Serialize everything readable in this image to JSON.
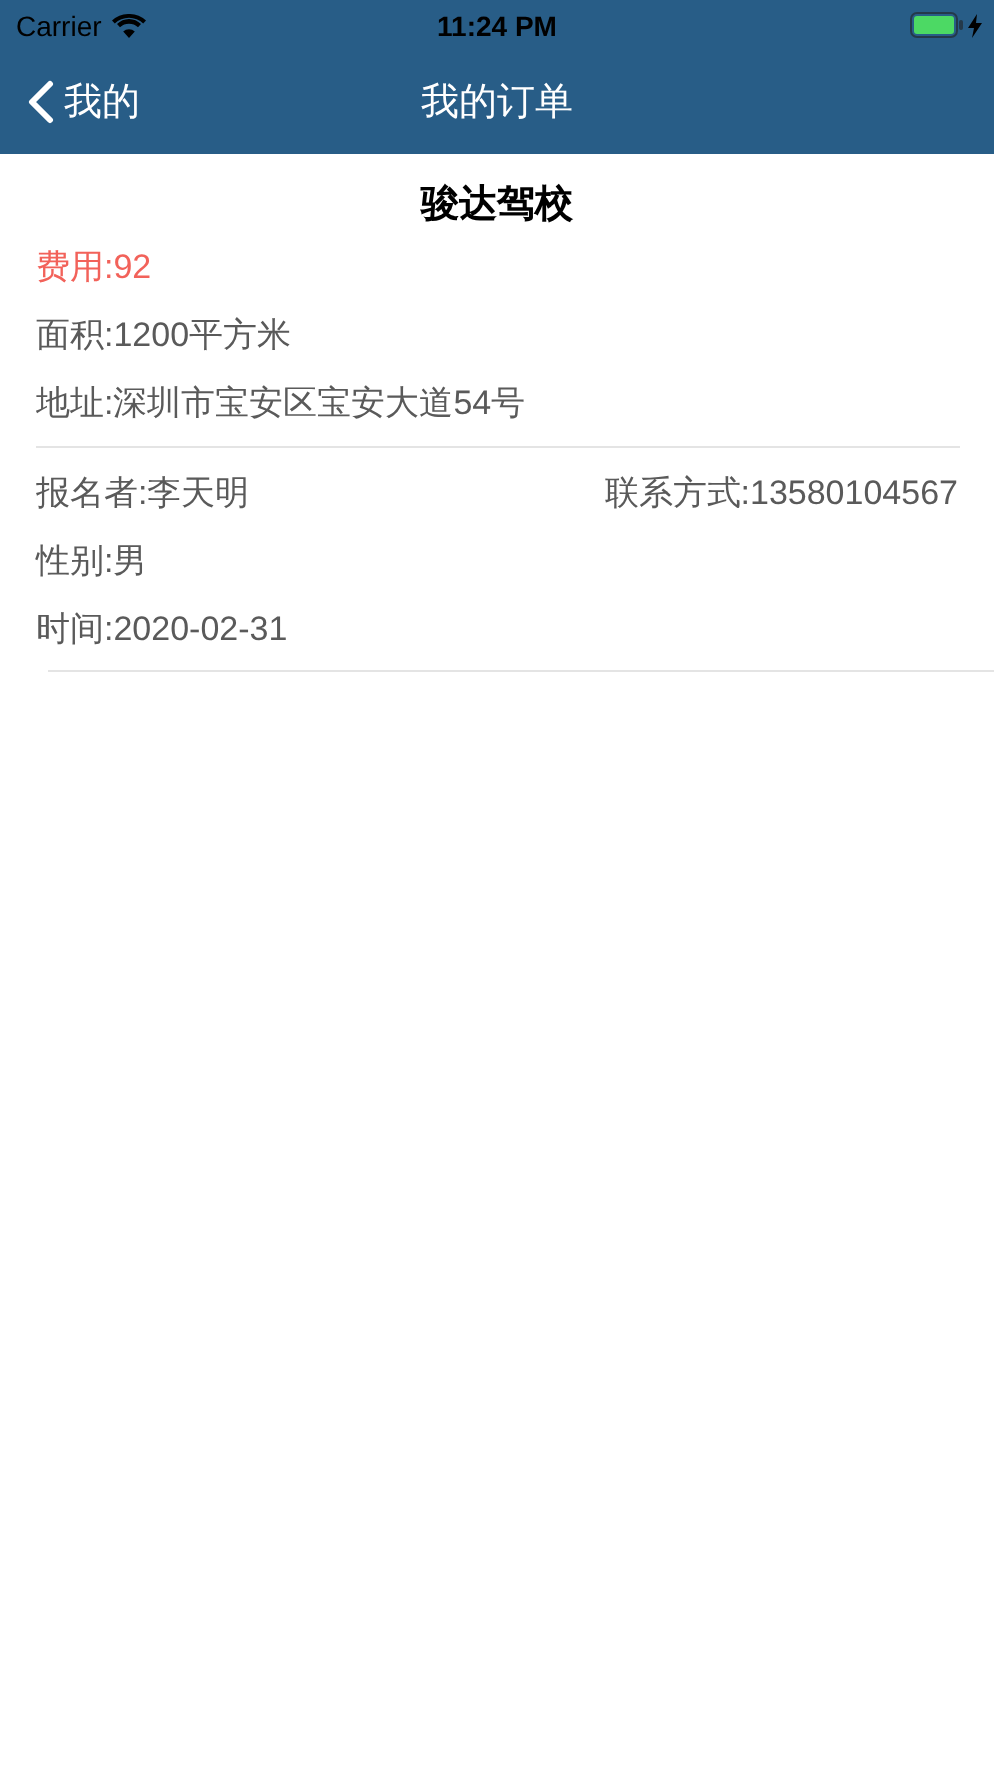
{
  "status_bar": {
    "carrier": "Carrier",
    "time": "11:24 PM"
  },
  "nav": {
    "back_label": "我的",
    "title": "我的订单"
  },
  "order": {
    "school": "骏达驾校",
    "details": [
      {
        "text": "费用:92",
        "kind": "price"
      },
      {
        "text": "面积:1200平方米",
        "kind": "info"
      },
      {
        "text": "地址:深圳市宝安区宝安大道54号",
        "kind": "info"
      }
    ],
    "applicant": {
      "name": "报名者:李天明",
      "contact": "联系方式:13580104567"
    },
    "extra": [
      "性别:男",
      "时间:2020-02-31"
    ]
  }
}
